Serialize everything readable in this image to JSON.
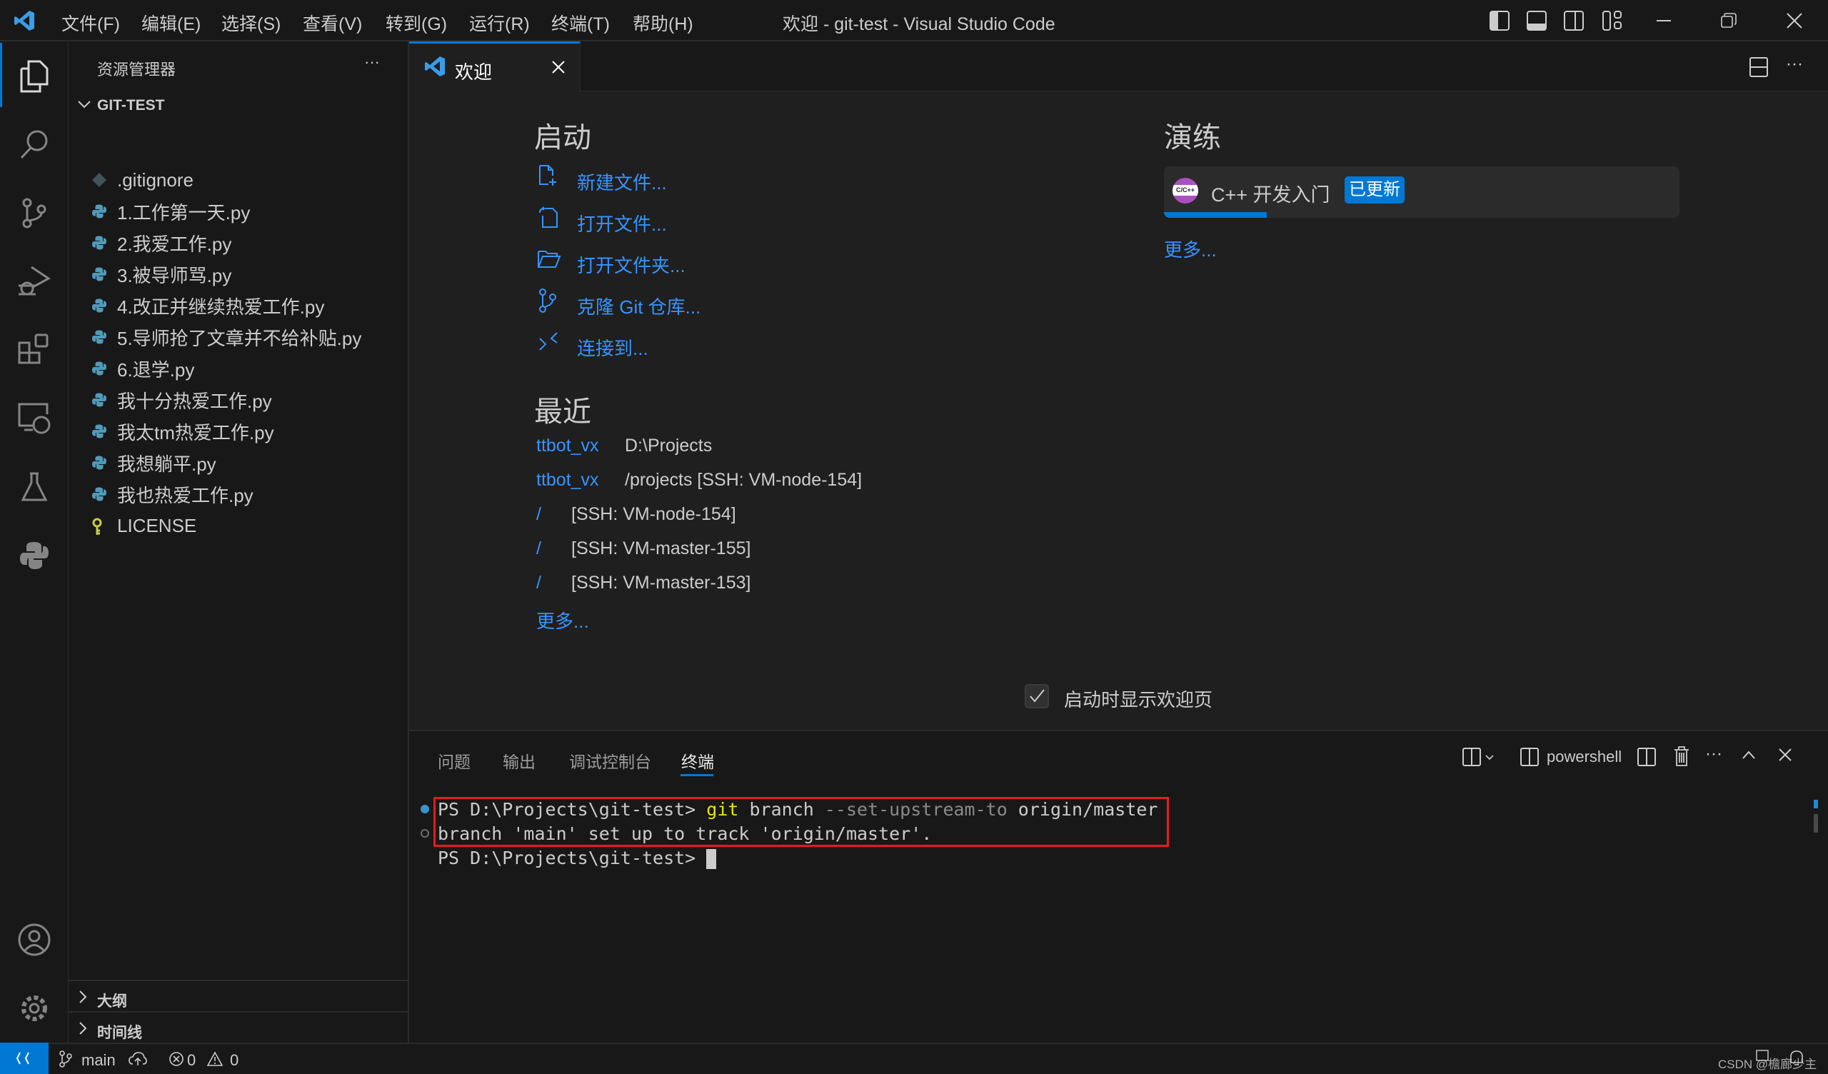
{
  "titlebar": {
    "title": "欢迎 - git-test - Visual Studio Code",
    "menu": [
      "文件(F)",
      "编辑(E)",
      "选择(S)",
      "查看(V)",
      "转到(G)",
      "运行(R)",
      "终端(T)",
      "帮助(H)"
    ]
  },
  "sidebar": {
    "title": "资源管理器",
    "more": "···",
    "folder": "GIT-TEST",
    "files": [
      {
        "name": ".gitignore",
        "icon": "git-icon"
      },
      {
        "name": "1.工作第一天.py",
        "icon": "python-icon"
      },
      {
        "name": "2.我爱工作.py",
        "icon": "python-icon"
      },
      {
        "name": "3.被导师骂.py",
        "icon": "python-icon"
      },
      {
        "name": "4.改正并继续热爱工作.py",
        "icon": "python-icon"
      },
      {
        "name": "5.导师抢了文章并不给补贴.py",
        "icon": "python-icon"
      },
      {
        "name": "6.退学.py",
        "icon": "python-icon"
      },
      {
        "name": "我十分热爱工作.py",
        "icon": "python-icon"
      },
      {
        "name": "我太tm热爱工作.py",
        "icon": "python-icon"
      },
      {
        "name": "我想躺平.py",
        "icon": "python-icon"
      },
      {
        "name": "我也热爱工作.py",
        "icon": "python-icon"
      },
      {
        "name": "LICENSE",
        "icon": "key-icon"
      }
    ],
    "outline": "大纲",
    "timeline": "时间线"
  },
  "tab": {
    "label": "欢迎"
  },
  "welcome": {
    "start_heading": "启动",
    "start_items": [
      "新建文件...",
      "打开文件...",
      "打开文件夹...",
      "克隆 Git 仓库...",
      "连接到..."
    ],
    "recent_heading": "最近",
    "recent": [
      {
        "name": "ttbot_vx",
        "path": "D:\\Projects"
      },
      {
        "name": "ttbot_vx",
        "path": "/projects [SSH: VM-node-154]"
      },
      {
        "name": "/",
        "path": "[SSH: VM-node-154]"
      },
      {
        "name": "/",
        "path": "[SSH: VM-master-155]"
      },
      {
        "name": "/",
        "path": "[SSH: VM-master-153]"
      }
    ],
    "recent_more": "更多...",
    "walkthrough_heading": "演练",
    "walkthrough": {
      "icon_text": "C/C++",
      "title": "C++ 开发入门",
      "badge": "已更新",
      "progress": 0.2
    },
    "walkthrough_more": "更多...",
    "show_on_startup": "启动时显示欢迎页",
    "show_on_startup_checked": true
  },
  "panel": {
    "tabs": [
      "问题",
      "输出",
      "调试控制台",
      "终端"
    ],
    "active_tab": "终端",
    "shell": "powershell",
    "lines": [
      {
        "prompt": "PS D:\\Projects\\git-test> ",
        "cmd": "git",
        "args1": " branch ",
        "flag": "--set-upstream-to",
        "args2": " origin/master"
      },
      {
        "output": "branch 'main' set up to track 'origin/master'."
      },
      {
        "prompt": "PS D:\\Projects\\git-test> "
      }
    ]
  },
  "statusbar": {
    "branch": "main",
    "errors": "0",
    "warnings": "0",
    "watermark": "CSDN @檐廊少主"
  },
  "colors": {
    "accent": "#0078d4",
    "link": "#3794ff",
    "highlight_box": "#e51c1c"
  }
}
